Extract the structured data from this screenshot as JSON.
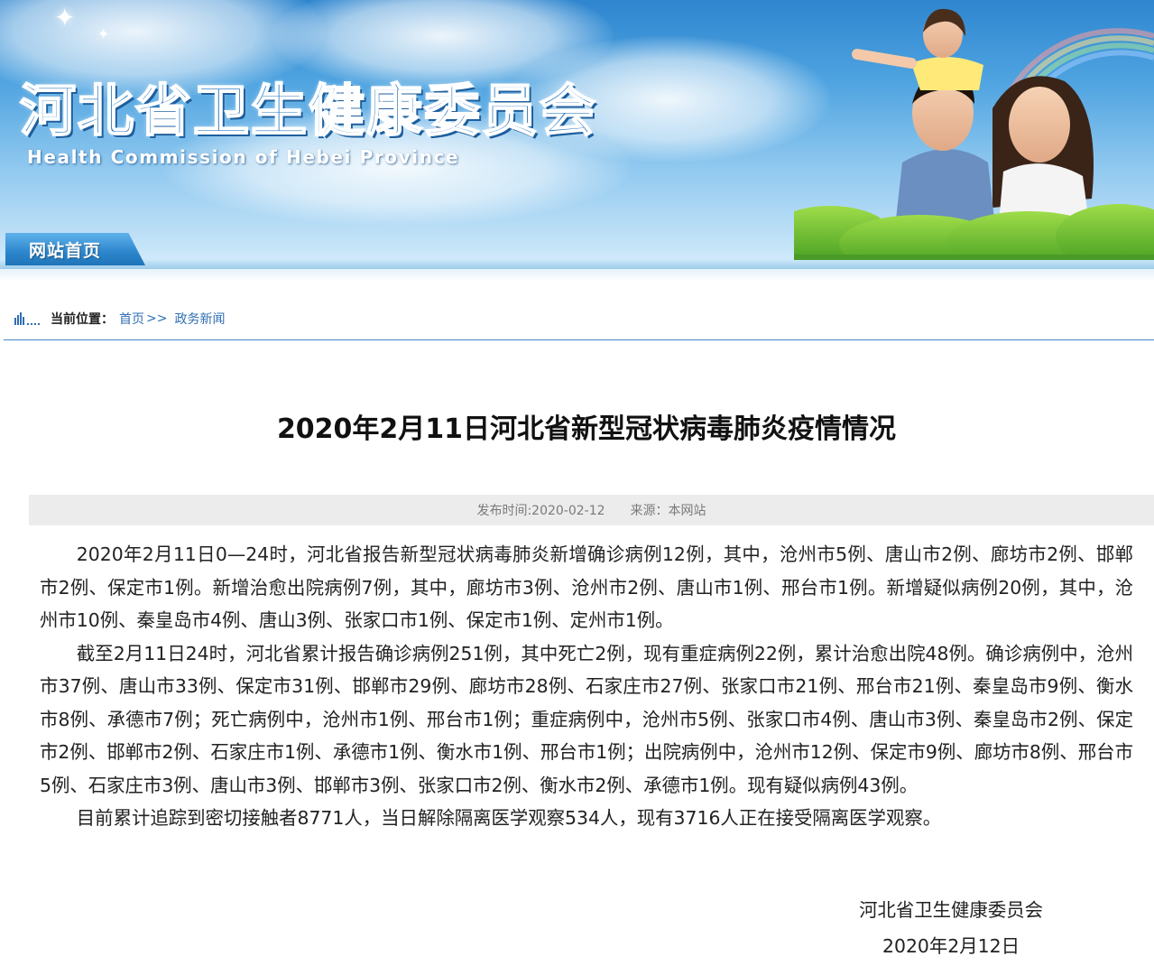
{
  "header": {
    "site_title": "河北省卫生健康委员会",
    "site_subtitle": "Health Commission of Hebei Province",
    "nav_home": "网站首页"
  },
  "breadcrumb": {
    "label": "当前位置：",
    "items": [
      {
        "text": "首页"
      },
      {
        "text": "政务新闻"
      }
    ],
    "separator": ">>"
  },
  "article": {
    "title": "2020年2月11日河北省新型冠状病毒肺炎疫情情况",
    "publish_time": "发布时间:2020-02-12",
    "source": "来源：本网站",
    "paragraphs": [
      "2020年2月11日0—24时，河北省报告新型冠状病毒肺炎新增确诊病例12例，其中，沧州市5例、唐山市2例、廊坊市2例、邯郸市2例、保定市1例。新增治愈出院病例7例，其中，廊坊市3例、沧州市2例、唐山市1例、邢台市1例。新增疑似病例20例，其中，沧州市10例、秦皇岛市4例、唐山3例、张家口市1例、保定市1例、定州市1例。",
      "截至2月11日24时，河北省累计报告确诊病例251例，其中死亡2例，现有重症病例22例，累计治愈出院48例。确诊病例中，沧州市37例、唐山市33例、保定市31例、邯郸市29例、廊坊市28例、石家庄市27例、张家口市21例、邢台市21例、秦皇岛市9例、衡水市8例、承德市7例；死亡病例中，沧州市1例、邢台市1例；重症病例中，沧州市5例、张家口市4例、唐山市3例、秦皇岛市2例、保定市2例、邯郸市2例、石家庄市1例、承德市1例、衡水市1例、邢台市1例；出院病例中，沧州市12例、保定市9例、廊坊市8例、邢台市5例、石家庄市3例、唐山市3例、邯郸市3例、张家口市2例、衡水市2例、承德市1例。现有疑似病例43例。",
      "目前累计追踪到密切接触者8771人，当日解除隔离医学观察534人，现有3716人正在接受隔离医学观察。"
    ],
    "signature_org": "河北省卫生健康委员会",
    "signature_date": "2020年2月12日"
  }
}
